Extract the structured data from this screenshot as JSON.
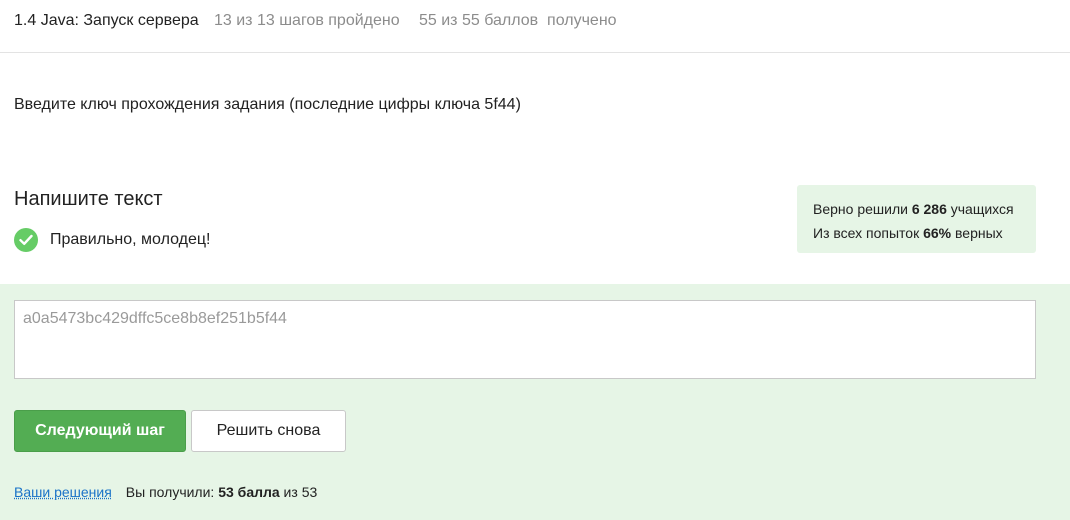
{
  "header": {
    "title": "1.4 Java: Запуск сервера",
    "steps": "13 из 13 шагов пройдено",
    "score": "55 из 55 баллов  получено"
  },
  "task": {
    "text": "Введите ключ прохождения задания (последние цифры ключа 5f44)"
  },
  "section": {
    "title": "Напишите текст"
  },
  "status": {
    "icon": "check-circle-icon",
    "text": "Правильно, молодец!",
    "color": "#66cc66"
  },
  "stats": {
    "line1_prefix": "Верно решили ",
    "line1_value": "6 286",
    "line1_suffix": " учащихся",
    "line2_prefix": "Из всех попыток ",
    "line2_value": "66%",
    "line2_suffix": " верных"
  },
  "answer": {
    "value": "a0a5473bc429dffc5ce8b8ef251b5f44"
  },
  "buttons": {
    "next_label": "Следующий шаг",
    "retry_label": "Решить снова"
  },
  "footer": {
    "solutions_link": "Ваши решения",
    "result_prefix": "Вы получили: ",
    "result_value": "53 балла",
    "result_suffix": " из 53"
  },
  "colors": {
    "accent": "#53ad53",
    "success_bg": "#e6f5e6",
    "link": "#1a73c8"
  }
}
